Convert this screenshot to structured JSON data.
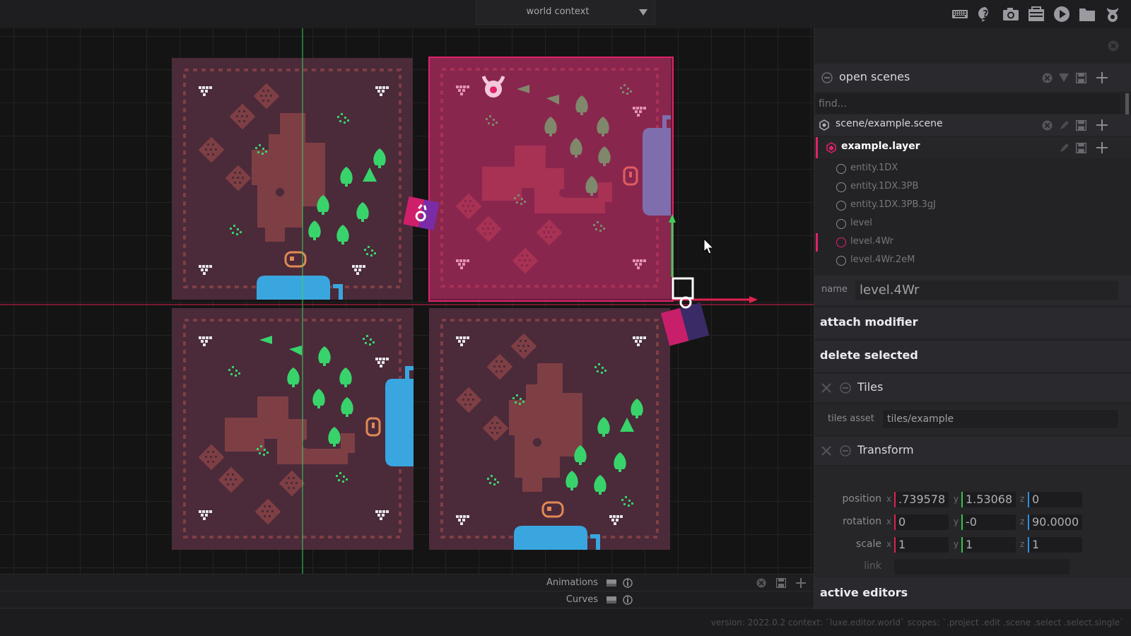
{
  "topbar": {
    "context_label": "world context",
    "icons": [
      "keyboard-icon",
      "help-icon",
      "camera-icon",
      "toolbox-icon",
      "play-icon",
      "folder-icon",
      "logo-icon"
    ]
  },
  "bottom_panel": {
    "animations_label": "Animations",
    "curves_label": "Curves"
  },
  "status": {
    "text": "version: 2022.0.2 context: `luxe.editor.world` scopes: `.project .edit .scene .select .select.single`"
  },
  "panel": {
    "open_scenes": {
      "title": "open scenes",
      "find_placeholder": "find...",
      "scene_name": "scene/example.scene",
      "layer_name": "example.layer",
      "entities": [
        "entity.1DX",
        "entity.1DX.3PB",
        "entity.1DX.3PB.3gJ",
        "level",
        "level.4Wr",
        "level.4Wr.2eM"
      ]
    },
    "name_label": "name",
    "name_value": "level.4Wr",
    "attach_modifier": "attach modifier",
    "delete_selected": "delete selected",
    "tiles": {
      "title": "Tiles",
      "asset_label": "tiles asset",
      "asset_value": "tiles/example"
    },
    "transform": {
      "title": "Transform",
      "position_label": "position",
      "rotation_label": "rotation",
      "scale_label": "scale",
      "link_label": "link",
      "axis_x": "x",
      "axis_y": "y",
      "axis_z": "z",
      "position": {
        "x": ".739578",
        "y": "1.53068",
        "z": "0"
      },
      "rotation": {
        "x": "0",
        "y": "-0",
        "z": "90.0000"
      },
      "scale": {
        "x": "1",
        "y": "1",
        "z": "1"
      }
    },
    "active_editors": "active editors"
  },
  "colors": {
    "accent_pink": "#e0216b",
    "tile_bg": "#4b2a3a",
    "selected_tile": "#8e2455",
    "path_brown": "#7e3f44",
    "leaf_green": "#39d36b",
    "water_blue": "#3aa6df"
  }
}
